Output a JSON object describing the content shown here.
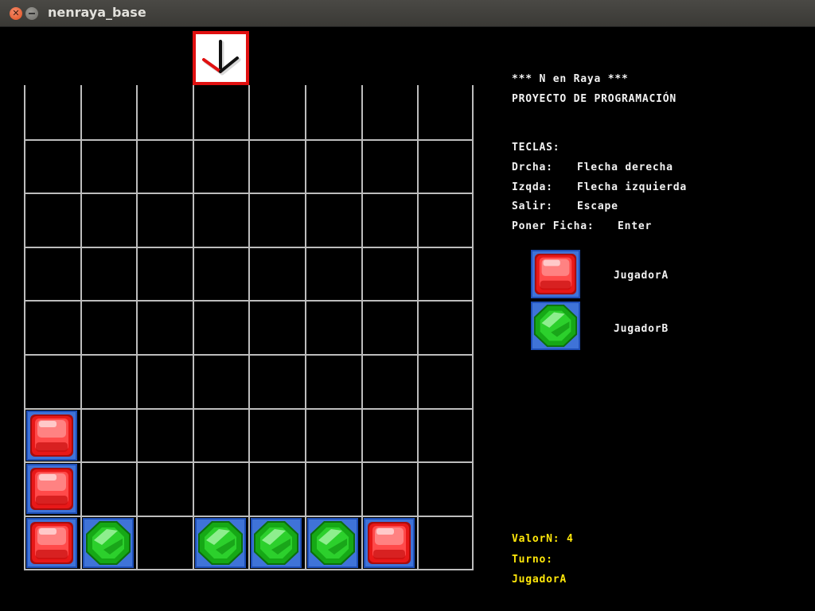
{
  "window": {
    "title": "nenraya_base",
    "close_icon": "close-icon",
    "minimize_icon": "minimize-icon"
  },
  "game": {
    "columns": 8,
    "rows": 9,
    "selector_column": 4,
    "selector_icon": "down-arrow-icon",
    "pieces": [
      {
        "row": 7,
        "col": 1,
        "player": "A"
      },
      {
        "row": 8,
        "col": 1,
        "player": "A"
      },
      {
        "row": 9,
        "col": 1,
        "player": "A"
      },
      {
        "row": 9,
        "col": 2,
        "player": "B"
      },
      {
        "row": 9,
        "col": 4,
        "player": "B"
      },
      {
        "row": 9,
        "col": 5,
        "player": "B"
      },
      {
        "row": 9,
        "col": 6,
        "player": "B"
      },
      {
        "row": 9,
        "col": 7,
        "player": "A"
      }
    ],
    "colors": {
      "grid": "#bdbdbd",
      "player_a": "#e81818",
      "player_b": "#16a816",
      "piece_frame": "#1e4fb8",
      "highlight_text": "#ffe70a"
    }
  },
  "info": {
    "title": "*** N en Raya ***",
    "subtitle": "PROYECTO DE PROGRAMACIÓN",
    "keys_header": "TECLAS:",
    "keys": [
      {
        "label": "Drcha:",
        "value": "Flecha derecha"
      },
      {
        "label": "Izqda:",
        "value": "Flecha izquierda"
      },
      {
        "label": "Salir:",
        "value": "Escape"
      },
      {
        "label": "Poner Ficha:",
        "value": "Enter"
      }
    ],
    "legend": [
      {
        "player": "A",
        "name": "JugadorA",
        "icon": "red-gem-icon"
      },
      {
        "player": "B",
        "name": "JugadorB",
        "icon": "green-gem-icon"
      }
    ],
    "valor_n_label": "ValorN: 4",
    "turno_label": "Turno:",
    "turno_value": "JugadorA"
  }
}
